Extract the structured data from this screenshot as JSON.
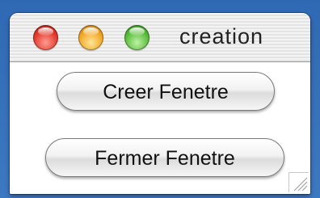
{
  "window": {
    "title": "creation"
  },
  "buttons": {
    "create_label": "Creer Fenetre",
    "close_label": "Fermer Fenetre"
  },
  "icons": {
    "close": "close-button-icon",
    "minimize": "minimize-button-icon",
    "zoom": "zoom-button-icon",
    "resize": "resize-grip-icon"
  },
  "colors": {
    "close": "#e23a2c",
    "minimize": "#f2a725",
    "zoom": "#58bd3a"
  }
}
